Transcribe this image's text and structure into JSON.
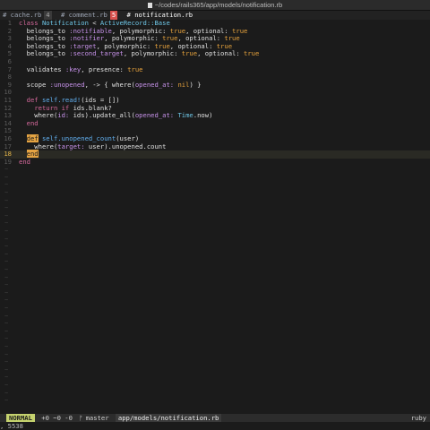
{
  "window": {
    "title": "~/codes/rails365/app/models/notification.rb"
  },
  "tabs": [
    {
      "icon": "#",
      "label": "cache.rb",
      "num": "4"
    },
    {
      "icon": "#",
      "label": "comment.rb",
      "num": "5"
    },
    {
      "icon": "#",
      "label": "notification.rb"
    }
  ],
  "code": [
    {
      "n": "1",
      "tokens": [
        [
          "kw",
          "class "
        ],
        [
          "cl",
          "Notification"
        ],
        [
          "id",
          " < "
        ],
        [
          "cl",
          "ActiveRecord::Base"
        ]
      ]
    },
    {
      "n": "2",
      "tokens": [
        [
          "id",
          "  belongs_to "
        ],
        [
          "sy",
          ":notifiable"
        ],
        [
          "id",
          ", polymorphic: "
        ],
        [
          "bo",
          "true"
        ],
        [
          "id",
          ", optional: "
        ],
        [
          "bo",
          "true"
        ]
      ]
    },
    {
      "n": "3",
      "tokens": [
        [
          "id",
          "  belongs_to "
        ],
        [
          "sy",
          ":notifier"
        ],
        [
          "id",
          ", polymorphic: "
        ],
        [
          "bo",
          "true"
        ],
        [
          "id",
          ", optional: "
        ],
        [
          "bo",
          "true"
        ]
      ]
    },
    {
      "n": "4",
      "tokens": [
        [
          "id",
          "  belongs_to "
        ],
        [
          "sy",
          ":target"
        ],
        [
          "id",
          ", polymorphic: "
        ],
        [
          "bo",
          "true"
        ],
        [
          "id",
          ", optional: "
        ],
        [
          "bo",
          "true"
        ]
      ]
    },
    {
      "n": "5",
      "tokens": [
        [
          "id",
          "  belongs_to "
        ],
        [
          "sy",
          ":second_target"
        ],
        [
          "id",
          ", polymorphic: "
        ],
        [
          "bo",
          "true"
        ],
        [
          "id",
          ", optional: "
        ],
        [
          "bo",
          "true"
        ]
      ]
    },
    {
      "n": "6",
      "tokens": []
    },
    {
      "n": "7",
      "tokens": [
        [
          "id",
          "  validates "
        ],
        [
          "sy",
          ":key"
        ],
        [
          "id",
          ", presence: "
        ],
        [
          "bo",
          "true"
        ]
      ]
    },
    {
      "n": "8",
      "tokens": []
    },
    {
      "n": "9",
      "tokens": [
        [
          "id",
          "  scope "
        ],
        [
          "sy",
          ":unopened"
        ],
        [
          "id",
          ", -> { where("
        ],
        [
          "sy",
          "opened_at:"
        ],
        [
          "id",
          " "
        ],
        [
          "bo",
          "nil"
        ],
        [
          "id",
          ") }"
        ]
      ]
    },
    {
      "n": "10",
      "tokens": []
    },
    {
      "n": "11",
      "tokens": [
        [
          "id",
          "  "
        ],
        [
          "kw",
          "def "
        ],
        [
          "fn",
          "self.read!"
        ],
        [
          "id",
          "(ids = [])"
        ]
      ]
    },
    {
      "n": "12",
      "tokens": [
        [
          "id",
          "    "
        ],
        [
          "kw",
          "return if "
        ],
        [
          "id",
          "ids.blank?"
        ]
      ]
    },
    {
      "n": "13",
      "tokens": [
        [
          "id",
          "    where("
        ],
        [
          "sy",
          "id:"
        ],
        [
          "id",
          " ids).update_all("
        ],
        [
          "sy",
          "opened_at:"
        ],
        [
          "id",
          " "
        ],
        [
          "cl",
          "Time"
        ],
        [
          "id",
          ".now)"
        ]
      ]
    },
    {
      "n": "14",
      "tokens": [
        [
          "id",
          "  "
        ],
        [
          "kw",
          "end"
        ]
      ]
    },
    {
      "n": "15",
      "tokens": []
    },
    {
      "n": "16",
      "tokens": [
        [
          "id",
          "  "
        ],
        [
          "hl",
          "def"
        ],
        [
          "id",
          " "
        ],
        [
          "fn",
          "self.unopened_count"
        ],
        [
          "id",
          "(user)"
        ]
      ]
    },
    {
      "n": "17",
      "tokens": [
        [
          "id",
          "    where("
        ],
        [
          "sy",
          "target:"
        ],
        [
          "id",
          " user).unopened.count"
        ]
      ]
    },
    {
      "n": "18",
      "tokens": [
        [
          "id",
          "  "
        ],
        [
          "hl",
          "end"
        ]
      ],
      "current": true
    },
    {
      "n": "19",
      "tokens": [
        [
          "kw",
          "end"
        ]
      ]
    }
  ],
  "empty_marker": "~",
  "statusline": {
    "mode": "NORMAL",
    "diff": "+0 ~0 -0",
    "branch_icon": "ᚠ",
    "branch": "master",
    "file": "app/models/notification.rb",
    "filetype": "ruby"
  },
  "cmdline": ", 5538",
  "colors": {
    "mode_bg": "#c5d26e",
    "modified_tab": "#d9534f",
    "match_highlight": "#e5a443"
  }
}
